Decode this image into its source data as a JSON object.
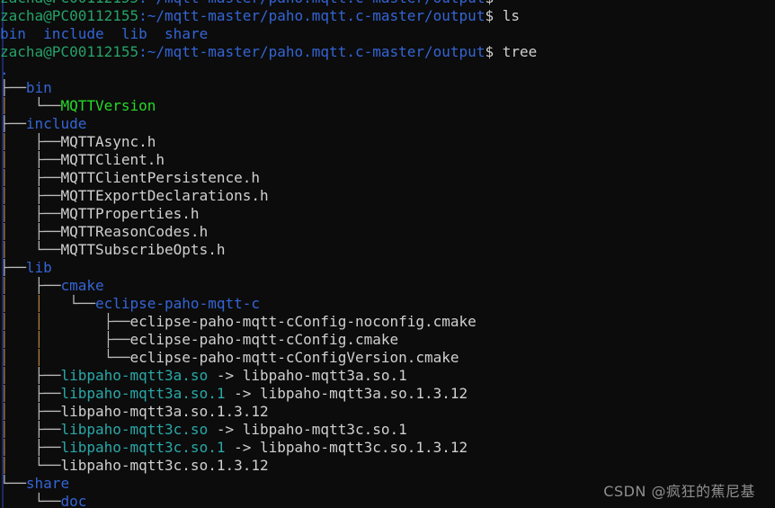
{
  "terminal": {
    "background_color": "#0c0c0c",
    "foreground_color": "#cccccc",
    "colors": {
      "prompt_user": "#26a269",
      "directory": "#3465d4",
      "executable": "#26d926",
      "symlink": "#2aa8a8",
      "branch": "#b8b8b8",
      "trunk": "#b5833f",
      "edge": "#1b2a6b",
      "watermark": "#8f8f8f"
    }
  },
  "prompt": {
    "user_host": "zacha@PC00112155",
    "separator": ":",
    "path": "~/mqtt-master/paho.mqtt.c-master/output",
    "sigil": "$"
  },
  "lines": [
    {
      "id": "prompt-clipped",
      "type": "prompt",
      "command": ""
    },
    {
      "id": "prompt-ls",
      "type": "prompt",
      "command": "ls"
    },
    {
      "id": "ls-output",
      "type": "ls",
      "entries": [
        "bin",
        "include",
        "lib",
        "share"
      ]
    },
    {
      "id": "prompt-tree",
      "type": "prompt",
      "command": "tree"
    },
    {
      "id": "tree-root",
      "type": "tree",
      "branch": "",
      "name": ".",
      "kind": "dir-root",
      "target": ""
    },
    {
      "id": "tree-bin",
      "type": "tree",
      "branch": "├──",
      "name": "bin",
      "kind": "dir",
      "target": ""
    },
    {
      "id": "tree-mqttversion",
      "type": "tree",
      "branch": "│   └──",
      "name": "MQTTVersion",
      "kind": "exec",
      "target": ""
    },
    {
      "id": "tree-include",
      "type": "tree",
      "branch": "├──",
      "name": "include",
      "kind": "dir",
      "target": ""
    },
    {
      "id": "tree-mqttasync-h",
      "type": "tree",
      "branch": "│   ├──",
      "name": "MQTTAsync.h",
      "kind": "file",
      "target": ""
    },
    {
      "id": "tree-mqttclient-h",
      "type": "tree",
      "branch": "│   ├──",
      "name": "MQTTClient.h",
      "kind": "file",
      "target": ""
    },
    {
      "id": "tree-mqttclientpersistence-h",
      "type": "tree",
      "branch": "│   ├──",
      "name": "MQTTClientPersistence.h",
      "kind": "file",
      "target": ""
    },
    {
      "id": "tree-mqttexportdeclarations-h",
      "type": "tree",
      "branch": "│   ├──",
      "name": "MQTTExportDeclarations.h",
      "kind": "file",
      "target": ""
    },
    {
      "id": "tree-mqttproperties-h",
      "type": "tree",
      "branch": "│   ├──",
      "name": "MQTTProperties.h",
      "kind": "file",
      "target": ""
    },
    {
      "id": "tree-mqttreasoncodes-h",
      "type": "tree",
      "branch": "│   ├──",
      "name": "MQTTReasonCodes.h",
      "kind": "file",
      "target": ""
    },
    {
      "id": "tree-mqttsubscribeopts-h",
      "type": "tree",
      "branch": "│   └──",
      "name": "MQTTSubscribeOpts.h",
      "kind": "file",
      "target": ""
    },
    {
      "id": "tree-lib",
      "type": "tree",
      "branch": "├──",
      "name": "lib",
      "kind": "dir",
      "target": ""
    },
    {
      "id": "tree-cmake",
      "type": "tree",
      "branch": "│   ├──",
      "name": "cmake",
      "kind": "dir",
      "target": ""
    },
    {
      "id": "tree-eclipse-paho-mqtt-c",
      "type": "tree",
      "branch": "│   │   └──",
      "name": "eclipse-paho-mqtt-c",
      "kind": "dir",
      "target": ""
    },
    {
      "id": "tree-cfg-noconfig",
      "type": "tree",
      "branch": "│   │       ├──",
      "name": "eclipse-paho-mqtt-cConfig-noconfig.cmake",
      "kind": "file",
      "target": ""
    },
    {
      "id": "tree-cfg",
      "type": "tree",
      "branch": "│   │       ├──",
      "name": "eclipse-paho-mqtt-cConfig.cmake",
      "kind": "file",
      "target": ""
    },
    {
      "id": "tree-cfg-version",
      "type": "tree",
      "branch": "│   │       └──",
      "name": "eclipse-paho-mqtt-cConfigVersion.cmake",
      "kind": "file",
      "target": ""
    },
    {
      "id": "tree-lib3a-so",
      "type": "tree",
      "branch": "│   ├──",
      "name": "libpaho-mqtt3a.so",
      "kind": "link",
      "target": "libpaho-mqtt3a.so.1"
    },
    {
      "id": "tree-lib3a-so-1",
      "type": "tree",
      "branch": "│   ├──",
      "name": "libpaho-mqtt3a.so.1",
      "kind": "link",
      "target": "libpaho-mqtt3a.so.1.3.12"
    },
    {
      "id": "tree-lib3a-so-1312",
      "type": "tree",
      "branch": "│   ├──",
      "name": "libpaho-mqtt3a.so.1.3.12",
      "kind": "file",
      "target": ""
    },
    {
      "id": "tree-lib3c-so",
      "type": "tree",
      "branch": "│   ├──",
      "name": "libpaho-mqtt3c.so",
      "kind": "link",
      "target": "libpaho-mqtt3c.so.1"
    },
    {
      "id": "tree-lib3c-so-1",
      "type": "tree",
      "branch": "│   ├──",
      "name": "libpaho-mqtt3c.so.1",
      "kind": "link",
      "target": "libpaho-mqtt3c.so.1.3.12"
    },
    {
      "id": "tree-lib3c-so-1312",
      "type": "tree",
      "branch": "│   └──",
      "name": "libpaho-mqtt3c.so.1.3.12",
      "kind": "file",
      "target": ""
    },
    {
      "id": "tree-share",
      "type": "tree",
      "branch": "└──",
      "name": "share",
      "kind": "dir",
      "target": ""
    },
    {
      "id": "tree-doc",
      "type": "tree",
      "branch": "    └──",
      "name": "doc",
      "kind": "dir",
      "target": ""
    }
  ],
  "watermark": {
    "text": "CSDN @疯狂的蕉尼基"
  }
}
